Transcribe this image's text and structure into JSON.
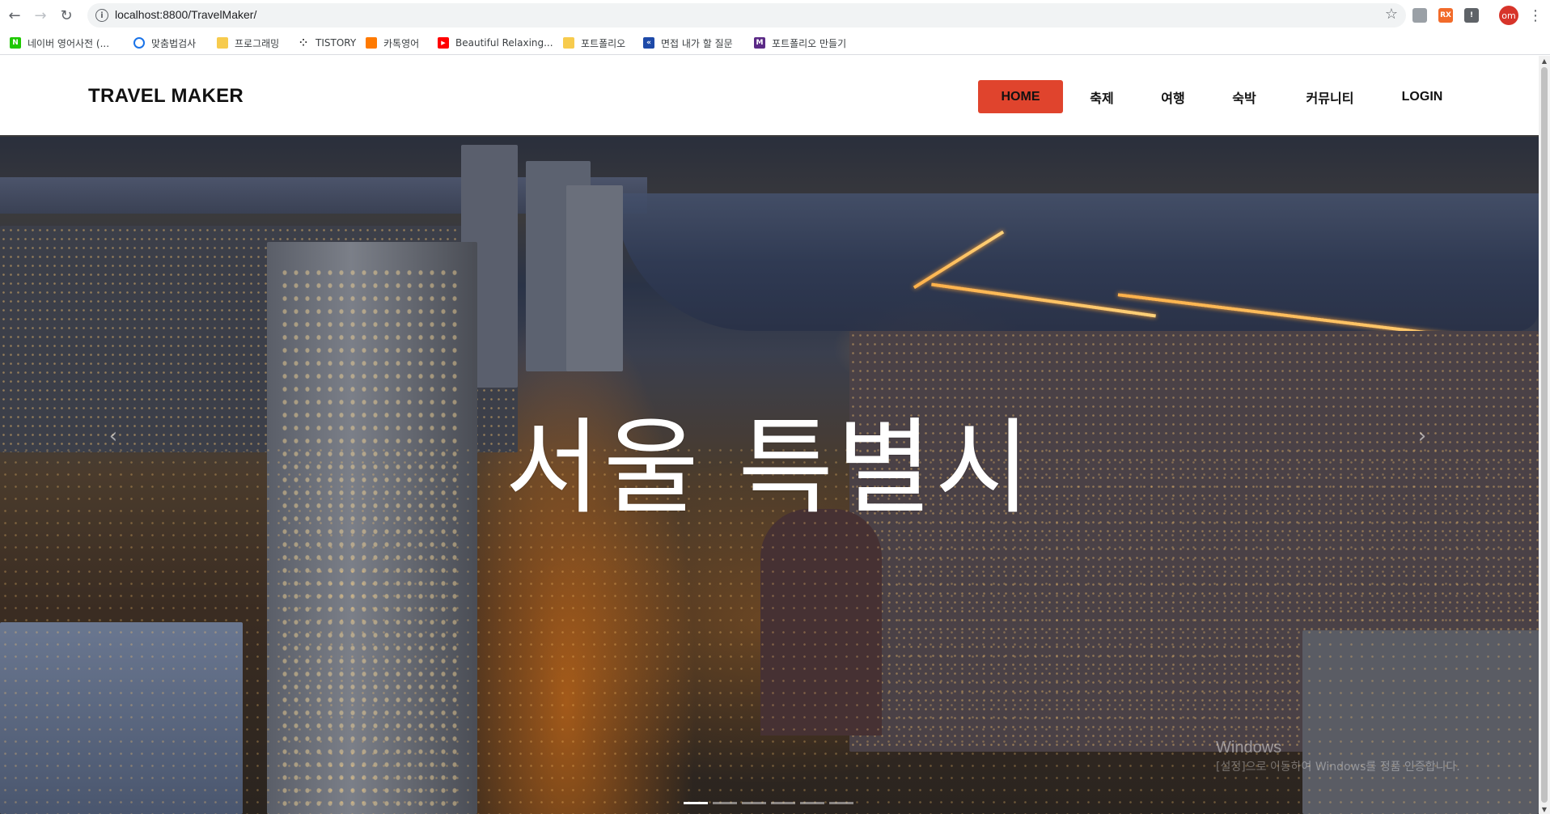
{
  "browser": {
    "url": "localhost:8800/TravelMaker/",
    "profile_initials": "om",
    "bookmarks": [
      {
        "label": "네이버 영어사전 (...",
        "icon": "naver-dict-icon",
        "color": "#1ec800"
      },
      {
        "label": "맞춤법검사",
        "icon": "speech-bubble-icon",
        "color": "#1a73e8"
      },
      {
        "label": "프로그래밍",
        "icon": "folder-icon",
        "color": "#f7cb4d"
      },
      {
        "label": "TISTORY",
        "icon": "tistory-icon",
        "color": "#333333"
      },
      {
        "label": "카톡영어",
        "icon": "kakao-icon",
        "color": "#ff7a00"
      },
      {
        "label": "Beautiful Relaxing...",
        "icon": "youtube-icon",
        "color": "#ff0000"
      },
      {
        "label": "포트폴리오",
        "icon": "folder-icon",
        "color": "#f7cb4d"
      },
      {
        "label": "면접 내가 할 질문",
        "icon": "bookmark-app-icon",
        "color": "#1e4aa8"
      },
      {
        "label": "포트폴리오 만들기",
        "icon": "m-app-icon",
        "color": "#5b2a86"
      }
    ]
  },
  "site": {
    "brand": "TRAVEL MAKER",
    "nav": [
      {
        "label": "HOME",
        "active": true
      },
      {
        "label": "축제",
        "active": false
      },
      {
        "label": "여행",
        "active": false
      },
      {
        "label": "숙박",
        "active": false
      },
      {
        "label": "커뮤니티",
        "active": false
      },
      {
        "label": "LOGIN",
        "active": false
      }
    ],
    "accent_color": "#e0442d"
  },
  "hero": {
    "title": "서울 특별시",
    "prev_arrow": "‹",
    "next_arrow": "›",
    "slide_count": 6,
    "active_slide": 1
  },
  "os_watermark": {
    "title": "Windows",
    "subtitle": "[설정]으로 이동하여 Windows를 정품 인증합니다."
  }
}
